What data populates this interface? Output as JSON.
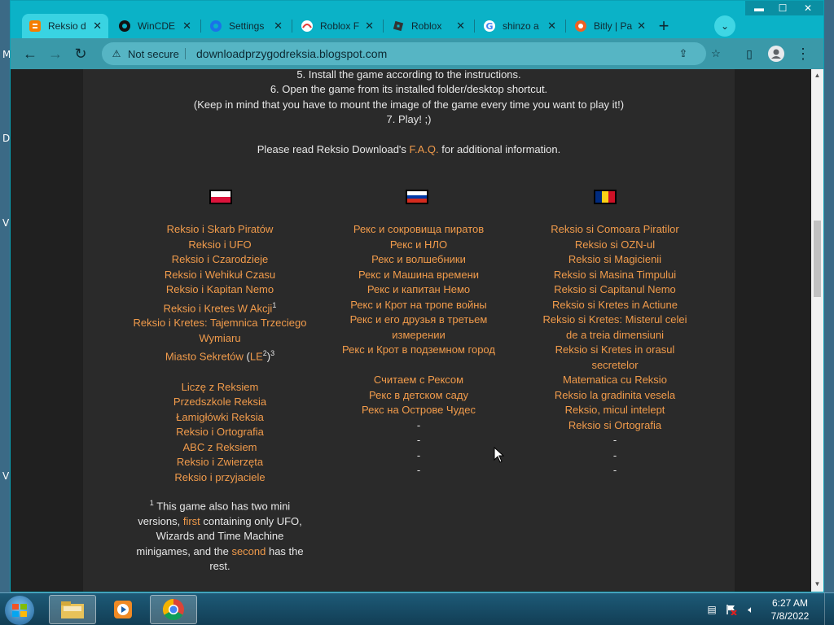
{
  "desktop": {
    "letters": [
      "M",
      "D",
      "V",
      "V"
    ]
  },
  "browser": {
    "tabs": [
      {
        "title": "Reksio d",
        "icon": "blogger-icon",
        "active": true
      },
      {
        "title": "WinCDE",
        "icon": "gear-icon"
      },
      {
        "title": "Settings",
        "icon": "settings-gear-icon"
      },
      {
        "title": "Roblox F",
        "icon": "roblox-icon"
      },
      {
        "title": "Roblox",
        "icon": "roblox-icon"
      },
      {
        "title": "shinzo a",
        "icon": "google-icon"
      },
      {
        "title": "Bitly | Pa",
        "icon": "bitly-icon"
      }
    ],
    "window_controls": {
      "minimize": "▬",
      "maximize": "☐",
      "close": "✕"
    },
    "security_label": "Not secure",
    "url": "downloadprzygodreksia.blogspot.com"
  },
  "page": {
    "instructions": [
      "5. Install the game according to the instructions.",
      "6. Open the game from its installed folder/desktop shortcut.",
      "(Keep in mind that you have to mount the image of the game every time you want to play it!)",
      "7. Play! ;)"
    ],
    "faq_prefix": "Please read Reksio Download's ",
    "faq_link": "F.A.Q.",
    "faq_suffix": " for additional information.",
    "colors": {
      "link": "#f19b4b",
      "background": "#2a2a2a",
      "text": "#e8e8e8"
    },
    "polish": {
      "games": [
        "Reksio i Skarb Piratów",
        "Reksio i UFO",
        "Reksio i Czarodzieje",
        "Reksio i Wehikuł Czasu",
        "Reksio i Kapitan Nemo",
        "Reksio i Kretes W Akcji",
        "Reksio i Kretes: Tajemnica Trzeciego",
        "Wymiaru",
        "Miasto Sekretów",
        "Liczę z Reksiem",
        "Przedszkole Reksia",
        "Łamigłówki Reksia",
        "Reksio i Ortografia",
        "ABC z Reksiem",
        "Reksio i Zwierzęta",
        "Reksio i przyjaciele"
      ],
      "sup1": "1",
      "le_open": " (",
      "le_text": "LE",
      "le_sup": "2",
      "le_close": ")",
      "sup3": "3"
    },
    "russian": {
      "games": [
        "Рекс и сокровища пиратов",
        "Рекс и НЛО",
        "Рекс и волшебники",
        "Рекс и Машина времени",
        "Рекс и капитан Немо",
        "Рекс и Крот на тропе войны",
        "Рекс и его друзья в третьем",
        "измерении",
        "Рекс и Крот в подземном город",
        "Считаем с Рексом",
        "Рекс в детском саду",
        "Рекс на Острове Чудес"
      ],
      "dash": "-"
    },
    "romanian": {
      "games": [
        "Reksio si Comoara Piratilor",
        "Reksio si OZN-ul",
        "Reksio si Magicienii",
        "Reksio si Masina Timpului",
        "Reksio si Capitanul Nemo",
        "Reksio si Kretes in Actiune",
        "Reksio si Kretes: Misterul celei",
        "de a treia dimensiuni",
        "Reksio si Kretes in orasul",
        "secretelor",
        "Matematica cu Reksio",
        "Reksio la gradinita vesela",
        "Reksio, micul intelept",
        "Reksio si Ortografia"
      ],
      "dash": "-"
    },
    "footnote": {
      "sup": "1",
      "text1": " This game also has two mini versions, ",
      "link1": "first",
      "text2": " containing only UFO, Wizards and Time Machine minigames, and the ",
      "link2": "second",
      "text3": " has the rest."
    }
  },
  "taskbar": {
    "time": "6:27 AM",
    "date": "7/8/2022"
  }
}
